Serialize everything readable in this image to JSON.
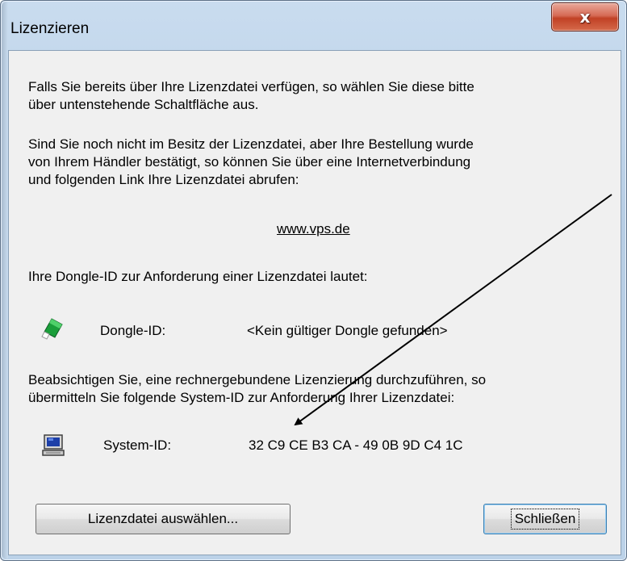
{
  "window": {
    "title": "Lizenzieren",
    "close_label": "x"
  },
  "body": {
    "para1_line1": "Falls Sie bereits über Ihre Lizenzdatei verfügen, so wählen Sie diese bitte",
    "para1_line2": "über untenstehende Schaltfläche aus.",
    "para2_line1": "Sind Sie noch nicht im Besitz der Lizenzdatei, aber Ihre Bestellung wurde",
    "para2_line2": "von Ihrem Händler bestätigt, so können Sie über eine Internetverbindung",
    "para2_line3": "und folgenden Link Ihre Lizenzdatei abrufen:",
    "link": "www.vps.de",
    "dongle_intro": "Ihre Dongle-ID zur Anforderung einer Lizenzdatei lautet:",
    "dongle_label": "Dongle-ID:",
    "dongle_value": "<Kein gültiger Dongle gefunden>",
    "para3_line1": "Beabsichtigen Sie, eine rechnergebundene Lizenzierung durchzuführen, so",
    "para3_line2": "übermitteln Sie folgende System-ID zur Anforderung Ihrer Lizenzdatei:",
    "system_label": "System-ID:",
    "system_value": "32 C9 CE B3 CA - 49 0B 9D C4 1C"
  },
  "buttons": {
    "select_file": "Lizenzdatei auswählen...",
    "close": "Schließen"
  },
  "icons": {
    "dongle": "usb-dongle-icon",
    "computer": "computer-icon",
    "dongle_color": "#1a9e3a"
  }
}
